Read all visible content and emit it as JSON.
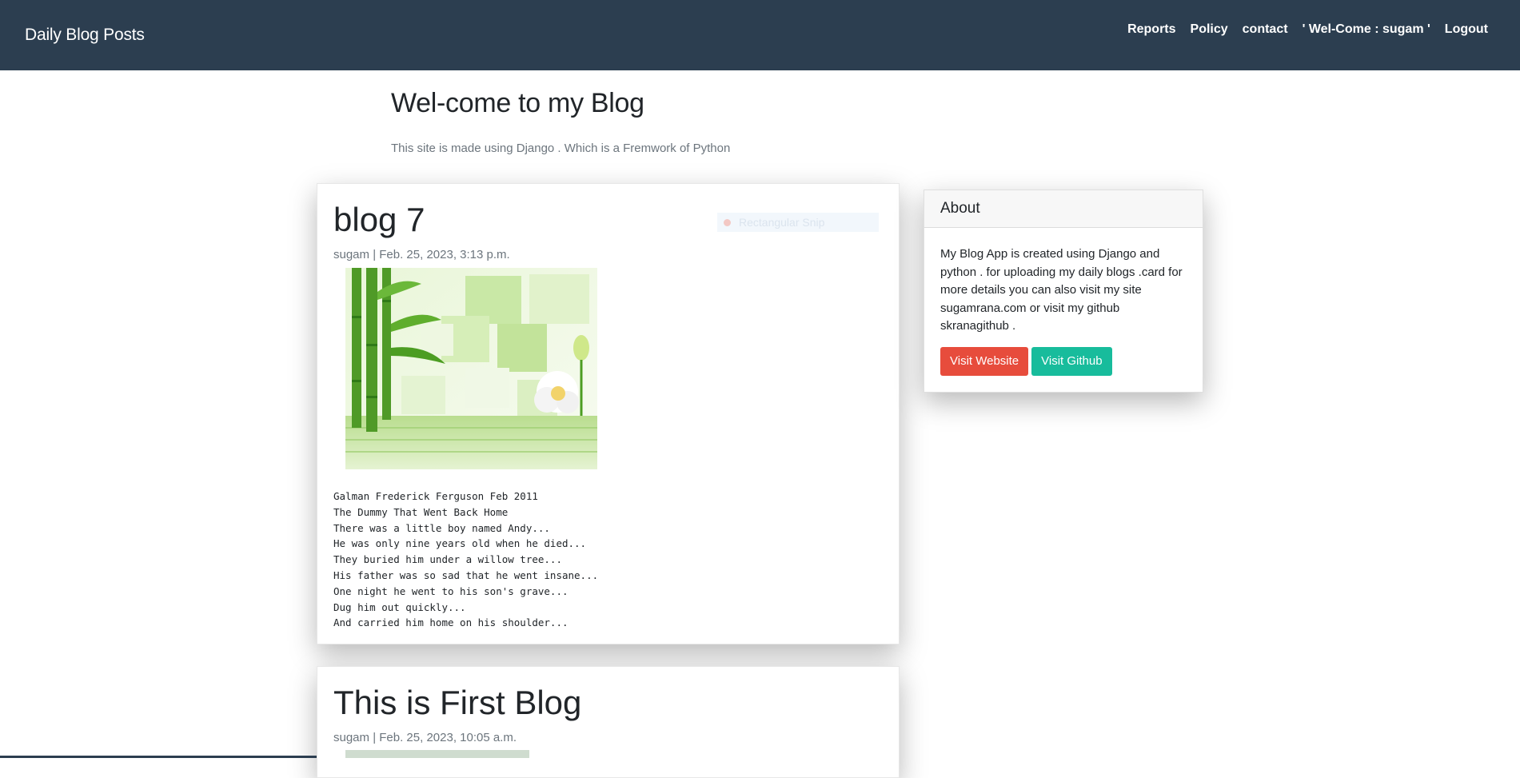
{
  "navbar": {
    "brand": "Daily Blog Posts",
    "links": [
      "Reports",
      "Policy",
      "contact",
      "' Wel-Come : sugam '",
      "Logout"
    ]
  },
  "masthead": {
    "title": "Wel-come to my Blog",
    "subtitle": "This site is made using Django . Which is a Fremwork of Python"
  },
  "posts": [
    {
      "title": "blog 7",
      "meta": "sugam | Feb. 25, 2023, 3:13 p.m.",
      "overlay_text": "Rectangular Snip",
      "body": [
        "Galman Frederick Ferguson Feb 2011",
        "The Dummy That Went Back Home",
        "There was a little boy named Andy...",
        "He was only nine years old when he died...",
        "They buried him under a willow tree...",
        "His father was so sad that he went insane...",
        "One night he went to his son's grave...",
        "Dug him out quickly...",
        "And carried him home on his shoulder..."
      ]
    },
    {
      "title": "This is First Blog",
      "meta": "sugam | Feb. 25, 2023, 10:05 a.m."
    }
  ],
  "about": {
    "heading": "About",
    "text": "My Blog App is created using Django and python . for uploading my daily blogs .card for more details you can also visit my site sugamrana.com or visit my github skranagithub .",
    "visit_website": "Visit Website",
    "visit_github": "Visit Github"
  },
  "colors": {
    "navbar": "#2c3e50",
    "danger": "#e74c3c",
    "success": "#18bc9c",
    "muted": "#6c757d"
  }
}
